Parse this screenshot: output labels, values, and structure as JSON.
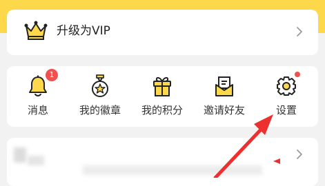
{
  "vip": {
    "label": "升级为VIP",
    "icon": "crown-icon"
  },
  "menu": {
    "items": [
      {
        "label": "消息",
        "icon": "bell-icon",
        "badge": "1"
      },
      {
        "label": "我的徽章",
        "icon": "medal-icon"
      },
      {
        "label": "我的积分",
        "icon": "gift-icon"
      },
      {
        "label": "邀请好友",
        "icon": "envelope-icon"
      },
      {
        "label": "设置",
        "icon": "gear-icon",
        "dot": true
      }
    ]
  },
  "colors": {
    "brand_yellow": "#fcd84a",
    "icon_stroke": "#222222",
    "badge_red": "#f2504f",
    "annotation_red": "#ee2f2f"
  }
}
